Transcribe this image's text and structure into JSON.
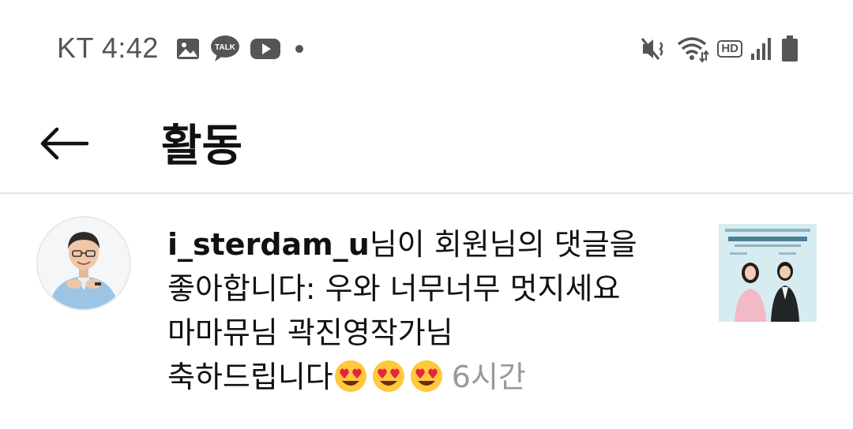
{
  "status_bar": {
    "carrier_time": "KT 4:42",
    "talk_badge": "TALK",
    "hd_badge": "HD",
    "left_icons": [
      "image-icon",
      "kakaotalk-icon",
      "youtube-icon",
      "dot-icon"
    ],
    "right_icons": [
      "mute-vibrate-icon",
      "wifi-icon",
      "hd-voice-icon",
      "signal-icon",
      "battery-icon"
    ]
  },
  "header": {
    "title": "활동",
    "back_icon": "arrow-left-icon"
  },
  "activity": {
    "username": "i_sterdam_u",
    "text_line1_suffix": "님이 회원님의 댓글을",
    "text_line2": "좋아합니다: 우와 너무너무 멋지세요",
    "text_line3": "마마뮤님 곽진영작가님",
    "text_line4": "축하드립니다",
    "emojis": [
      "😍",
      "😍",
      "😍"
    ],
    "time_ago": "6시간"
  },
  "colors": {
    "background": "#ffffff",
    "text": "#111111",
    "muted": "#999999",
    "status_icons": "#555555",
    "divider": "#e6e6e6"
  }
}
